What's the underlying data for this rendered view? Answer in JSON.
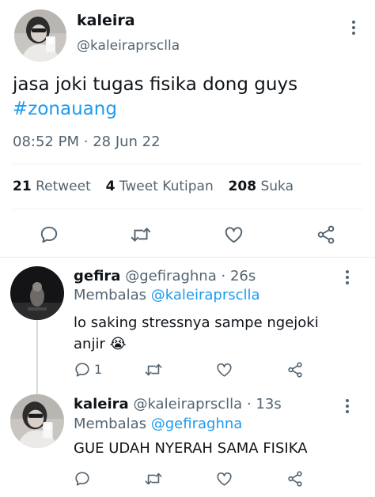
{
  "main_tweet": {
    "display_name": "kaleira",
    "handle": "@kaleiraprsclla",
    "text": "jasa joki tugas fisika dong guys",
    "hashtag": "#zonauang",
    "time": "08:52 PM",
    "separator": "·",
    "date": "28 Jun 22",
    "stats": {
      "retweets_count": "21",
      "retweets_label": "Retweet",
      "quotes_count": "4",
      "quotes_label": "Tweet Kutipan",
      "likes_count": "208",
      "likes_label": "Suka"
    },
    "actions": [
      "reply-icon",
      "retweet-icon",
      "like-icon",
      "share-icon"
    ]
  },
  "replies": [
    {
      "display_name": "gefira",
      "handle": "@gefiraghna",
      "separator": "·",
      "time": "26s",
      "replying_label": "Membalas",
      "replying_to": "@kaleiraprsclla",
      "text_line1": "lo saking stressnya sampe ngejoki",
      "text_line2": "anjir",
      "emoji": "😭",
      "reply_count": "1"
    },
    {
      "display_name": "kaleira",
      "handle": "@kaleiraprsclla",
      "separator": "·",
      "time": "13s",
      "replying_label": "Membalas",
      "replying_to": "@gefiraghna",
      "text_line1": "GUE UDAH NYERAH SAMA FISIKA",
      "reply_count": ""
    }
  ],
  "colors": {
    "accent": "#1d9bf0",
    "text": "#0f1419",
    "secondary": "#536471",
    "divider": "#eff3f4"
  }
}
